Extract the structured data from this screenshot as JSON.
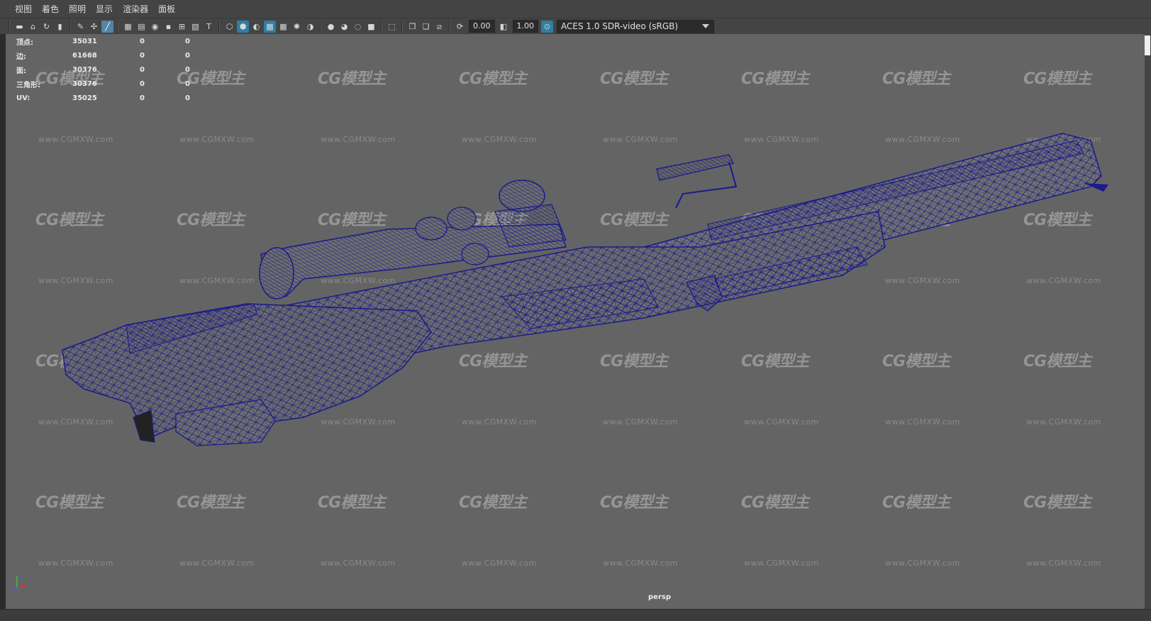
{
  "menu": [
    "视图",
    "着色",
    "照明",
    "显示",
    "渲染器",
    "面板"
  ],
  "toolbar": {
    "exposure_value": "0.00",
    "gamma_value": "1.00",
    "color_space": "ACES 1.0 SDR-video (sRGB)",
    "icons": [
      "camera-icon",
      "camera-attr-icon",
      "bookmark-icon",
      "image-plane-icon",
      "grid-icon",
      "resolution-gate-icon",
      "gate-mask-icon",
      "field-chart-icon",
      "safe-action-icon",
      "safe-title-icon",
      "wireframe-icon",
      "smooth-shade-icon",
      "wireframe-on-shaded-icon",
      "textured-icon",
      "use-lights-icon",
      "shadows-icon",
      "ambient-occlusion-icon",
      "motion-blur-icon",
      "anti-alias-icon",
      "depth-of-field-icon",
      "isolate-select-icon",
      "xray-icon",
      "xray-joints-icon",
      "xray-active-icon",
      "exposure-icon",
      "gamma-icon",
      "color-mgmt-icon"
    ]
  },
  "hud": {
    "rows": [
      {
        "label": "顶点:",
        "v1": "35031",
        "v2": "0",
        "v3": "0"
      },
      {
        "label": "边:",
        "v1": "61668",
        "v2": "0",
        "v3": "0"
      },
      {
        "label": "面:",
        "v1": "30376",
        "v2": "0",
        "v3": "0"
      },
      {
        "label": "三角形:",
        "v1": "30376",
        "v2": "0",
        "v3": "0"
      },
      {
        "label": "UV:",
        "v1": "35025",
        "v2": "0",
        "v3": "0"
      }
    ]
  },
  "viewport": {
    "camera": "persp",
    "wire_color": "#1a1a8c",
    "bg_color": "#646464"
  },
  "watermark": {
    "logo": "CG模型主",
    "url": "www.CGMXW.com"
  }
}
